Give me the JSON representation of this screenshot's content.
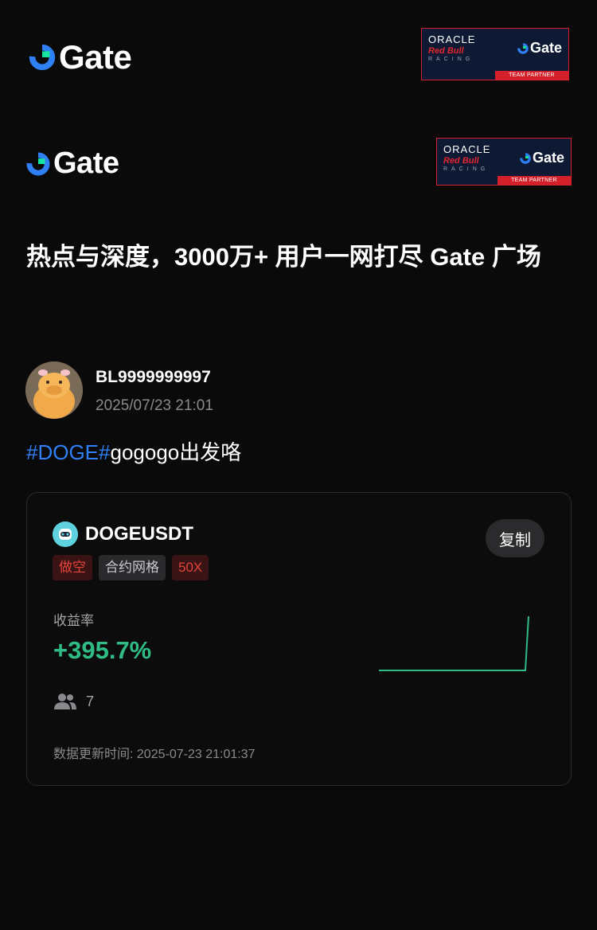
{
  "brand": {
    "name": "Gate",
    "partner": {
      "oracle": "ORACLE",
      "redbull": "Red Bull",
      "racing": "RACING",
      "gate": "Gate",
      "team_partner": "TEAM PARTNER"
    },
    "colors": {
      "blue": "#2f7ff5",
      "green_mark": "#17e3a0",
      "red": "#d3202a"
    }
  },
  "headline": "热点与深度，3000万+ 用户一网打尽 Gate 广场",
  "post": {
    "username": "BL9999999997",
    "timestamp": "2025/07/23 21:01",
    "hashtag": "#DOGE#",
    "text": "gogogo出发咯"
  },
  "card": {
    "pair": "DOGEUSDT",
    "copy_label": "复制",
    "tags": [
      "做空",
      "合约网格",
      "50X"
    ],
    "yield_label": "收益率",
    "yield_value": "+395.7%",
    "users_count": "7",
    "updated_label": "数据更新时间:",
    "updated_time": "2025-07-23 21:01:37",
    "colors": {
      "positive": "#2fbd85",
      "short": "#e4433d"
    }
  }
}
